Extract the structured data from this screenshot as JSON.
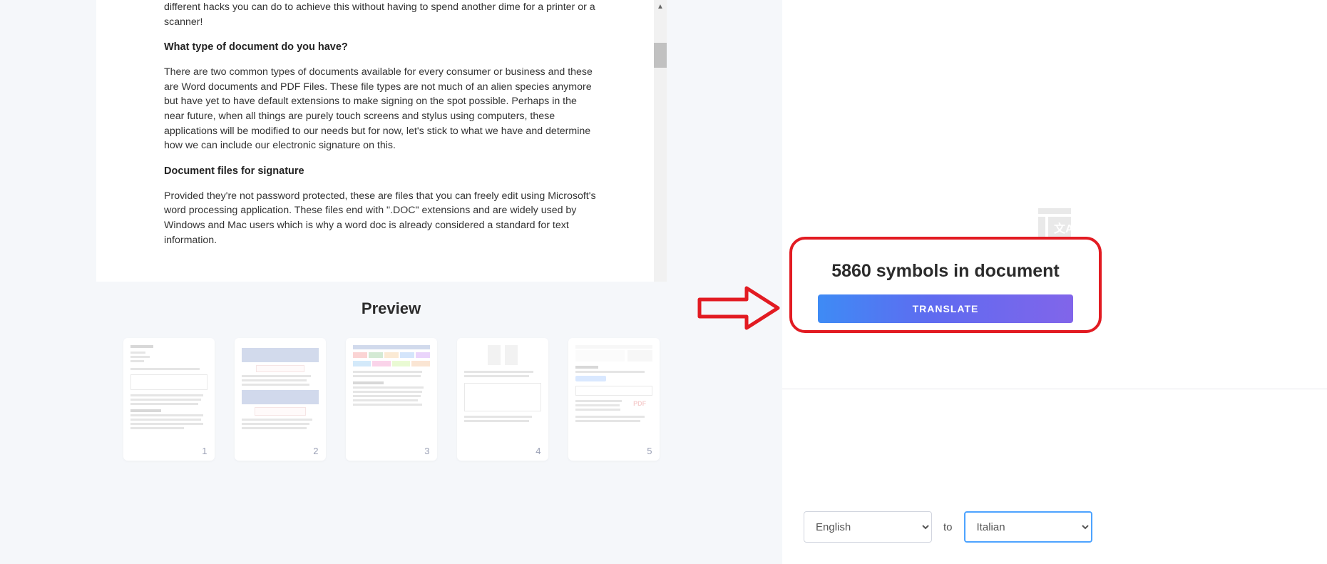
{
  "document": {
    "para_intro_tail": "different hacks you can do to achieve this without having to spend another dime for a printer or a scanner!",
    "heading_type": "What type of document do you have?",
    "para_type": "There are two common types of documents available for every consumer or business and these are Word documents and PDF Files. These file types are not much of an alien species anymore but have yet to have default extensions to make signing on the spot possible. Perhaps in the near future, when all things are purely touch screens and stylus using computers, these applications will be modified to our needs but for now, let's stick to what we have and determine how we can include our electronic signature on this.",
    "heading_sig": "Document files for signature",
    "para_sig": "Provided they're not password protected, these are files that you can freely edit using Microsoft's word processing application. These files end with \".DOC\" extensions and are widely used by Windows and Mac users which is why a word doc is already considered a standard for text information."
  },
  "preview": {
    "title": "Preview",
    "pages": [
      "1",
      "2",
      "3",
      "4",
      "5"
    ]
  },
  "translate": {
    "count_text": "5860 symbols in document",
    "button_label": "TRANSLATE",
    "to_label": "to",
    "source_lang": "English",
    "target_lang": "Italian"
  }
}
